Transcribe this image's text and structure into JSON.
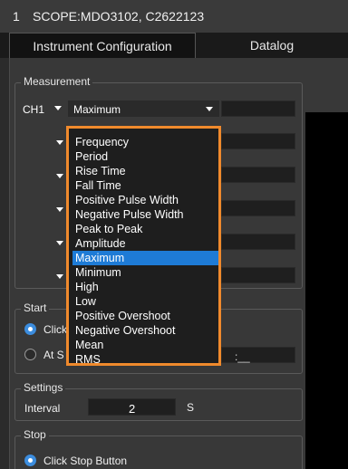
{
  "window": {
    "index": "1",
    "title": "SCOPE:MDO3102, C2622123"
  },
  "tabs": [
    {
      "label": "Instrument Configuration",
      "active": true
    },
    {
      "label": "Datalog",
      "active": false
    }
  ],
  "measurement": {
    "title": "Measurement",
    "row1": {
      "channel": "CH1",
      "measurement": "Maximum",
      "value": ""
    },
    "value_fields": [
      "",
      "",
      "",
      "",
      "",
      ""
    ]
  },
  "dropdown": {
    "options": [
      "Frequency",
      "Period",
      "Rise Time",
      "Fall Time",
      "Positive Pulse Width",
      "Negative Pulse Width",
      "Peak to Peak",
      "Amplitude",
      "Maximum",
      "Minimum",
      "High",
      "Low",
      "Positive Overshoot",
      "Negative Overshoot",
      "Mean",
      "RMS"
    ],
    "selected": "Maximum",
    "highlight_color": "#f08a2c"
  },
  "start": {
    "title": "Start",
    "option1_partial": "Click",
    "option2_partial": "At S",
    "time_suffix": ":__"
  },
  "settings": {
    "title": "Settings",
    "interval_label": "Interval",
    "interval_value": "2",
    "interval_unit": "S"
  },
  "stop": {
    "title": "Stop",
    "option1": "Click Stop Button"
  }
}
